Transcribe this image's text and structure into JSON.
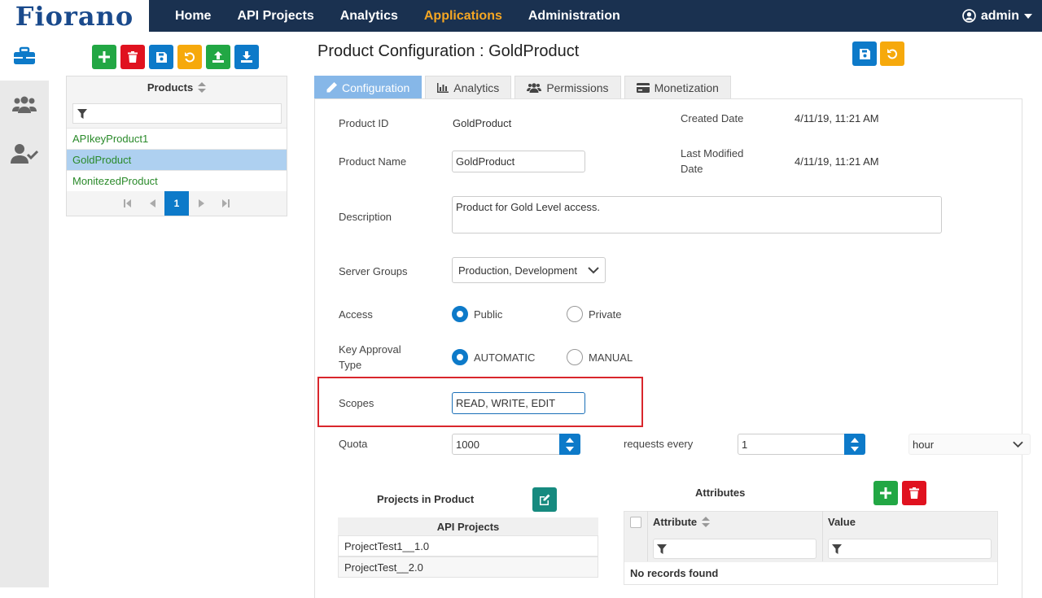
{
  "brand": {
    "logo": "Fiorano"
  },
  "nav": {
    "items": [
      "Home",
      "API Projects",
      "Analytics",
      "Applications",
      "Administration"
    ],
    "active": "Applications"
  },
  "user": {
    "name": "admin"
  },
  "sidebar": {
    "icons": [
      "briefcase-icon",
      "users-icon",
      "user-check-icon"
    ]
  },
  "products_panel": {
    "header": "Products",
    "items": [
      "APIkeyProduct1",
      "GoldProduct",
      "MonitezedProduct"
    ],
    "selected": "GoldProduct",
    "current_page": "1"
  },
  "page": {
    "title": "Product Configuration : GoldProduct"
  },
  "tabs": [
    "Configuration",
    "Analytics",
    "Permissions",
    "Monetization"
  ],
  "form": {
    "product_id_label": "Product ID",
    "product_id": "GoldProduct",
    "created_label": "Created Date",
    "created": "4/11/19, 11:21 AM",
    "product_name_label": "Product Name",
    "product_name": "GoldProduct",
    "modified_label_1": "Last Modified",
    "modified_label_2": "Date",
    "modified": "4/11/19, 11:21 AM",
    "description_label": "Description",
    "description": "Product for Gold Level access.",
    "server_groups_label": "Server Groups",
    "server_groups": "Production, Development",
    "access_label": "Access",
    "access_options": [
      "Public",
      "Private"
    ],
    "access_selected": "Public",
    "key_approval_label_1": "Key Approval",
    "key_approval_label_2": "Type",
    "key_approval_options": [
      "AUTOMATIC",
      "MANUAL"
    ],
    "key_approval_selected": "AUTOMATIC",
    "scopes_label": "Scopes",
    "scopes": "READ, WRITE, EDIT",
    "quota_label": "Quota",
    "quota": "1000",
    "requests_every_label": "requests every",
    "interval": "1",
    "unit": "hour"
  },
  "projects": {
    "title": "Projects in Product",
    "column": "API Projects",
    "rows": [
      "ProjectTest1__1.0",
      "ProjectTest__2.0"
    ]
  },
  "attributes": {
    "title": "Attributes",
    "columns": [
      "Attribute",
      "Value"
    ],
    "empty": "No records found"
  },
  "colors": {
    "nav_bg": "#1a3150",
    "accent": "#f5a623",
    "primary": "#0d7ac9",
    "highlight": "#d9262c"
  }
}
